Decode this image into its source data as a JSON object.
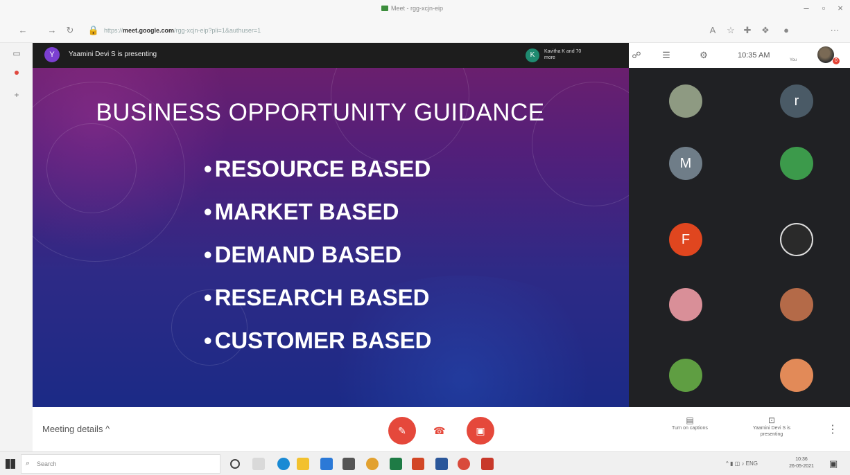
{
  "browser": {
    "tab_title": "Meet - rgg-xcjn-eip",
    "url_prefix": "https://",
    "url_domain": "meet.google.com",
    "url_rest": "/rgg-xcjn-eip?pli=1&authuser=1"
  },
  "meet": {
    "presenter_initial": "Y",
    "presenter_text": "Yaamini Devi S is presenting",
    "participants_initial": "K",
    "participants_text": "Kavitha K and 70 more",
    "participant_count": "70",
    "clock": "10:35 AM",
    "you_label": "You",
    "self_badge": "0"
  },
  "slide": {
    "title": "BUSINESS OPPORTUNITY GUIDANCE",
    "bullets": [
      "RESOURCE BASED",
      "MARKET BASED",
      "DEMAND BASED",
      "RESEARCH BASED",
      "CUSTOMER BASED"
    ]
  },
  "participants": [
    {
      "label": "",
      "color": "#8e9a82"
    },
    {
      "label": "r",
      "color": "#4a5a66"
    },
    {
      "label": "M",
      "color": "#6f7d88"
    },
    {
      "label": "",
      "color": "#3c9a4b"
    },
    {
      "label": "F",
      "color": "#e0461f"
    },
    {
      "label": "",
      "color": "#2a2a2a"
    },
    {
      "label": "",
      "color": "#d98f98"
    },
    {
      "label": "",
      "color": "#b46a48"
    },
    {
      "label": "",
      "color": "#5f9e42"
    },
    {
      "label": "",
      "color": "#e28a58"
    }
  ],
  "bottom": {
    "meeting_details": "Meeting details",
    "captions_label": "Turn on captions",
    "present_label": "Yaamini Devi S is presenting"
  },
  "taskbar": {
    "search_placeholder": "Search",
    "tray_text": "ENG",
    "time": "10:36",
    "date": "26-05-2021"
  },
  "colors": {
    "danger": "#e5483b",
    "meet_dark": "#1d1d1d",
    "grid_bg": "#202124"
  }
}
